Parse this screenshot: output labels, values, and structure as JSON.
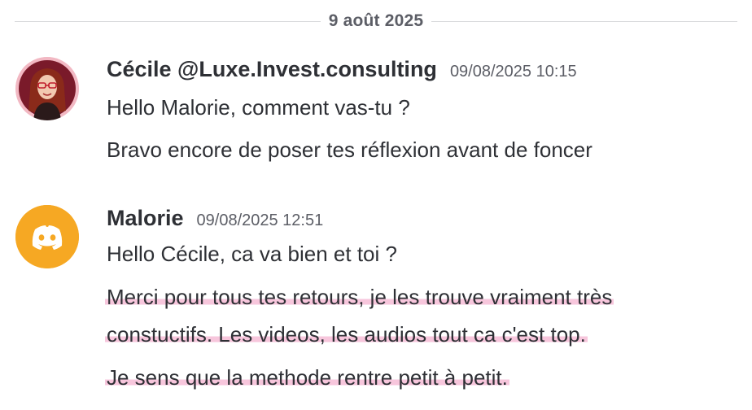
{
  "date_divider": "9 août 2025",
  "messages": [
    {
      "username": "Cécile @Luxe.Invest.consulting",
      "timestamp": "09/08/2025 10:15",
      "avatar_icon": "user-photo-avatar",
      "lines": [
        "Hello Malorie, comment vas-tu ?",
        "Bravo encore de poser tes réflexion avant de foncer"
      ]
    },
    {
      "username": "Malorie",
      "timestamp": "09/08/2025 12:51",
      "avatar_icon": "discord-logo-icon",
      "lines": [
        "Hello Cécile, ca va bien et toi ?",
        "Merci pour tous tes retours, je les trouve vraiment très",
        "constuctifs. Les videos, les audios tout ca c'est top.",
        "Je sens que la methode rentre petit à petit."
      ]
    }
  ],
  "colors": {
    "highlight": "#f7c6dc",
    "discord_avatar_bg": "#f6a823"
  }
}
